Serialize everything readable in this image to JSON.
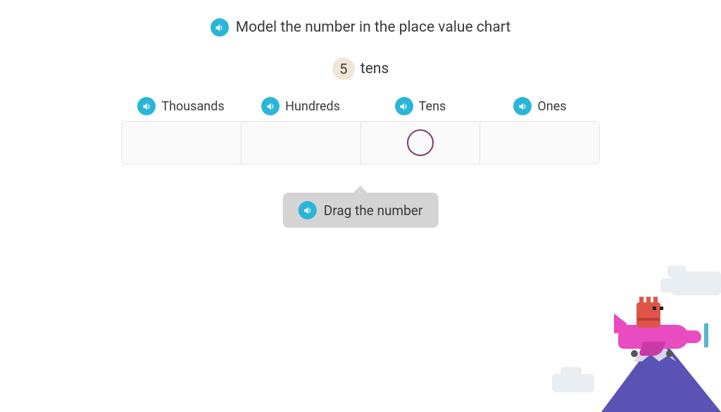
{
  "instruction": "Model the number in the place value chart",
  "prompt": {
    "number": "5",
    "unit": "tens"
  },
  "columns": [
    "Thousands",
    "Hundreds",
    "Tens",
    "Ones"
  ],
  "hint": "Drag the number",
  "drop_target_column_index": 2
}
